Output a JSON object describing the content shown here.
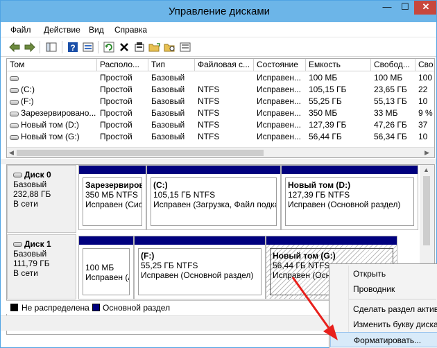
{
  "window": {
    "title": "Управление дисками",
    "min_glyph": "—",
    "max_glyph": "☐",
    "close_glyph": "✕"
  },
  "menu": [
    "Файл",
    "Действие",
    "Вид",
    "Справка"
  ],
  "toolbar_icons": [
    "back-arrow-icon",
    "forward-arrow-icon",
    "console-tree-icon",
    "help-icon",
    "properties-icon",
    "refresh-icon",
    "delete-icon",
    "properties-sheet-icon",
    "open-folder-icon",
    "explore-icon",
    "disk-list-icon"
  ],
  "volumes": {
    "columns": [
      "Том",
      "Располо...",
      "Тип",
      "Файловая с...",
      "Состояние",
      "Емкость",
      "Свобод...",
      "Сво"
    ],
    "rows": [
      [
        "",
        "Простой",
        "Базовый",
        "",
        "Исправен...",
        "100 МБ",
        "100 МБ",
        "100"
      ],
      [
        "(C:)",
        "Простой",
        "Базовый",
        "NTFS",
        "Исправен...",
        "105,15 ГБ",
        "23,65 ГБ",
        "22"
      ],
      [
        "(F:)",
        "Простой",
        "Базовый",
        "NTFS",
        "Исправен...",
        "55,25 ГБ",
        "55,13 ГБ",
        "10"
      ],
      [
        "Зарезервировано...",
        "Простой",
        "Базовый",
        "NTFS",
        "Исправен...",
        "350 МБ",
        "33 МБ",
        "9 %"
      ],
      [
        "Новый том (D:)",
        "Простой",
        "Базовый",
        "NTFS",
        "Исправен...",
        "127,39 ГБ",
        "47,26 ГБ",
        "37"
      ],
      [
        "Новый том (G:)",
        "Простой",
        "Базовый",
        "NTFS",
        "Исправен...",
        "56,44 ГБ",
        "56,34 ГБ",
        "10"
      ]
    ]
  },
  "disks": [
    {
      "name": "Диск 0",
      "type": "Базовый",
      "size": "232,88 ГБ",
      "status": "В сети",
      "partitions": [
        {
          "title": "Зарезервиров",
          "size": "350 МБ NTFS",
          "status": "Исправен (Сис"
        },
        {
          "title": "(C:)",
          "size": "105,15 ГБ NTFS",
          "status": "Исправен (Загрузка, Файл подка"
        },
        {
          "title": "Новый том  (D:)",
          "size": "127,39 ГБ NTFS",
          "status": "Исправен (Основной раздел)"
        }
      ]
    },
    {
      "name": "Диск 1",
      "type": "Базовый",
      "size": "111,79 ГБ",
      "status": "В сети",
      "partitions": [
        {
          "title": "",
          "size": "100 МБ",
          "status": "Исправен (А"
        },
        {
          "title": "(F:)",
          "size": "55,25 ГБ NTFS",
          "status": "Исправен (Основной раздел)"
        },
        {
          "title": "Новый том  (G:)",
          "size": "56,44 ГБ NTFS",
          "status": "Исправен (Основ"
        }
      ]
    }
  ],
  "legend": {
    "unallocated": "Не распределена",
    "primary": "Основной раздел",
    "unallocated_color": "#000000",
    "primary_color": "#00007e"
  },
  "context_menu": {
    "items": [
      "Открыть",
      "Проводник",
      "Сделать раздел активным",
      "Изменить букву диска",
      "Форматировать..."
    ]
  },
  "colors": {
    "titlebar": "#6cb5e8",
    "partition_bar": "#00007e",
    "close_button": "#c7473d",
    "highlight": "#d8eaf9",
    "arrow": "#e8201c"
  }
}
